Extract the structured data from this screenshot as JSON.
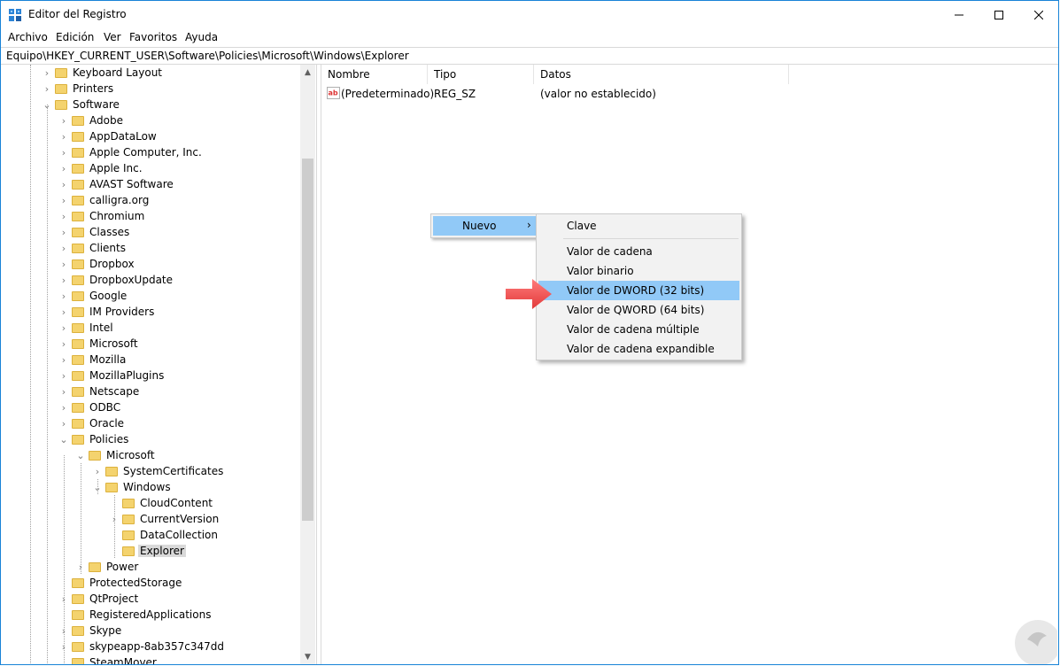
{
  "window": {
    "title": "Editor del Registro"
  },
  "menu": [
    "Archivo",
    "Edición",
    "Ver",
    "Favoritos",
    "Ayuda"
  ],
  "address": "Equipo\\HKEY_CURRENT_USER\\Software\\Policies\\Microsoft\\Windows\\Explorer",
  "tree": [
    {
      "label": "Keyboard Layout",
      "level": 0,
      "expander": "collapsed"
    },
    {
      "label": "Printers",
      "level": 0,
      "expander": "collapsed"
    },
    {
      "label": "Software",
      "level": 0,
      "expander": "expanded"
    },
    {
      "label": "Adobe",
      "level": 1,
      "expander": "collapsed"
    },
    {
      "label": "AppDataLow",
      "level": 1,
      "expander": "collapsed"
    },
    {
      "label": "Apple Computer, Inc.",
      "level": 1,
      "expander": "collapsed"
    },
    {
      "label": "Apple Inc.",
      "level": 1,
      "expander": "collapsed"
    },
    {
      "label": "AVAST Software",
      "level": 1,
      "expander": "collapsed"
    },
    {
      "label": "calligra.org",
      "level": 1,
      "expander": "collapsed"
    },
    {
      "label": "Chromium",
      "level": 1,
      "expander": "collapsed"
    },
    {
      "label": "Classes",
      "level": 1,
      "expander": "collapsed"
    },
    {
      "label": "Clients",
      "level": 1,
      "expander": "collapsed"
    },
    {
      "label": "Dropbox",
      "level": 1,
      "expander": "collapsed"
    },
    {
      "label": "DropboxUpdate",
      "level": 1,
      "expander": "collapsed"
    },
    {
      "label": "Google",
      "level": 1,
      "expander": "collapsed"
    },
    {
      "label": "IM Providers",
      "level": 1,
      "expander": "collapsed"
    },
    {
      "label": "Intel",
      "level": 1,
      "expander": "collapsed"
    },
    {
      "label": "Microsoft",
      "level": 1,
      "expander": "collapsed"
    },
    {
      "label": "Mozilla",
      "level": 1,
      "expander": "collapsed"
    },
    {
      "label": "MozillaPlugins",
      "level": 1,
      "expander": "collapsed"
    },
    {
      "label": "Netscape",
      "level": 1,
      "expander": "collapsed"
    },
    {
      "label": "ODBC",
      "level": 1,
      "expander": "collapsed"
    },
    {
      "label": "Oracle",
      "level": 1,
      "expander": "collapsed"
    },
    {
      "label": "Policies",
      "level": 1,
      "expander": "expanded"
    },
    {
      "label": "Microsoft",
      "level": 2,
      "expander": "expanded"
    },
    {
      "label": "SystemCertificates",
      "level": 3,
      "expander": "collapsed"
    },
    {
      "label": "Windows",
      "level": 3,
      "expander": "expanded"
    },
    {
      "label": "CloudContent",
      "level": 4,
      "expander": "none"
    },
    {
      "label": "CurrentVersion",
      "level": 4,
      "expander": "collapsed"
    },
    {
      "label": "DataCollection",
      "level": 4,
      "expander": "none"
    },
    {
      "label": "Explorer",
      "level": 4,
      "expander": "none",
      "selected": true
    },
    {
      "label": "Power",
      "level": 2,
      "expander": "collapsed"
    },
    {
      "label": "ProtectedStorage",
      "level": 1,
      "expander": "none"
    },
    {
      "label": "QtProject",
      "level": 1,
      "expander": "collapsed"
    },
    {
      "label": "RegisteredApplications",
      "level": 1,
      "expander": "none"
    },
    {
      "label": "Skype",
      "level": 1,
      "expander": "collapsed"
    },
    {
      "label": "skypeapp-8ab357c347dd",
      "level": 1,
      "expander": "collapsed"
    },
    {
      "label": "SteamMover",
      "level": 1,
      "expander": "none"
    }
  ],
  "list": {
    "columns": [
      "Nombre",
      "Tipo",
      "Datos"
    ],
    "rows": [
      {
        "name": "(Predeterminado)",
        "type": "REG_SZ",
        "data": "(valor no establecido)",
        "icon": "string-value-icon"
      }
    ]
  },
  "context_menu": {
    "item": "Nuevo",
    "arrow": "›",
    "submenu": [
      {
        "label": "Clave"
      },
      {
        "label": "Valor de cadena"
      },
      {
        "label": "Valor binario"
      },
      {
        "label": "Valor de DWORD (32 bits)",
        "highlighted": true
      },
      {
        "label": "Valor de QWORD (64 bits)"
      },
      {
        "label": "Valor de cadena múltiple"
      },
      {
        "label": "Valor de cadena expandible"
      }
    ]
  },
  "colors": {
    "accent": "#1883d7",
    "menu_highlight": "#91c9f7",
    "folder": "#f4d36e",
    "arrow": "#f45a5a"
  },
  "icons": {
    "app": "registry-editor-icon",
    "minimize": "minimize-icon",
    "maximize": "maximize-icon",
    "close": "close-icon"
  }
}
